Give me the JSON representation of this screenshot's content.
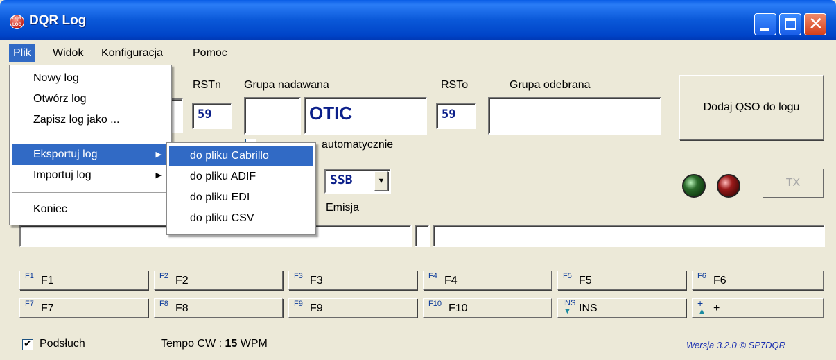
{
  "window": {
    "title": "DQR Log",
    "icon_text": "DQR LOG",
    "close_glyph": "✕"
  },
  "menubar": [
    "Plik",
    "Widok",
    "Konfiguracja",
    "Pomoc"
  ],
  "form": {
    "rstn_label": "RSTn",
    "grupa_nadawana_label": "Grupa nadawana",
    "rsto_label": "RSTo",
    "grupa_odebrana_label": "Grupa odebrana",
    "rstn_value": "59",
    "grupa_nadawana_value": "OTIC",
    "rsto_value": "59",
    "grupa_odebrana_value": "",
    "auto_label": "automatycznie",
    "emisja_value": "SSB",
    "emisja_label": "Emisja",
    "add_button": "Dodaj QSO do logu",
    "tx_button": "TX"
  },
  "fkeys": [
    {
      "small": "F1",
      "label": "F1"
    },
    {
      "small": "F2",
      "label": "F2"
    },
    {
      "small": "F3",
      "label": "F3"
    },
    {
      "small": "F4",
      "label": "F4"
    },
    {
      "small": "F5",
      "label": "F5"
    },
    {
      "small": "F6",
      "label": "F6"
    },
    {
      "small": "F7",
      "label": "F7"
    },
    {
      "small": "F8",
      "label": "F8"
    },
    {
      "small": "F9",
      "label": "F9"
    },
    {
      "small": "F10",
      "label": "F10"
    },
    {
      "small": "INS",
      "label": "INS"
    },
    {
      "small": "+",
      "label": "+"
    }
  ],
  "footer": {
    "podsluch_label": "Podsłuch",
    "podsluch_checked": "✔",
    "tempo_label": "Tempo CW : ",
    "tempo_value": "15",
    "tempo_unit": " WPM",
    "version": "Wersja 3.2.0 © SP7DQR"
  },
  "plik_menu": {
    "items": [
      "Nowy log",
      "Otwórz log",
      "Zapisz log jako ...",
      "Eksportuj log",
      "Importuj log",
      "Koniec"
    ]
  },
  "export_submenu": {
    "items": [
      "do pliku Cabrillo",
      "do pliku ADIF",
      "do pliku EDI",
      "do pliku CSV"
    ]
  },
  "colors": {
    "highlight": "#316ac5",
    "value_text": "#0b1f8a",
    "version_text": "#1a2fb0"
  },
  "icons": {
    "app": "dqr-log-icon",
    "submenu_arrow": "▶",
    "ins_arrow": "▼",
    "plus_arrow": "▲"
  }
}
